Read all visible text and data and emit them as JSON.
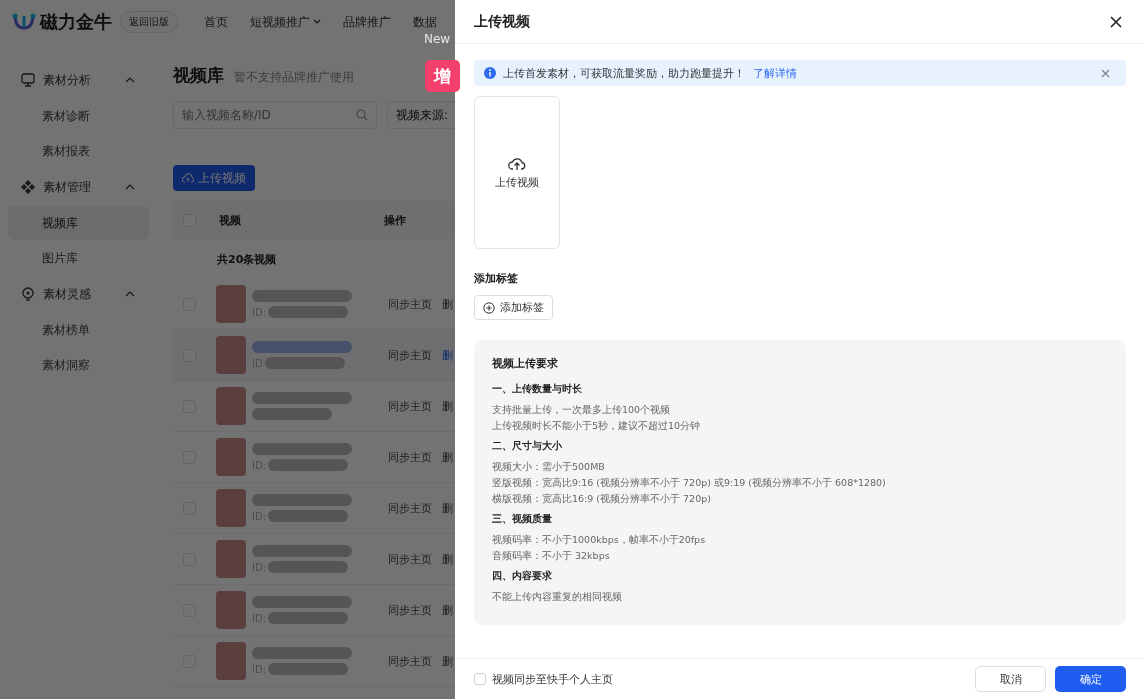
{
  "app": {
    "logo_text": "磁力金牛",
    "version_button": "返回旧版",
    "nav": [
      {
        "label": "首页",
        "dropdown": false
      },
      {
        "label": "短视频推广",
        "dropdown": true
      },
      {
        "label": "品牌推广",
        "dropdown": false
      },
      {
        "label": "数据",
        "dropdown": false
      }
    ],
    "new_badge": "New"
  },
  "sidebar": {
    "groups": [
      {
        "label": "素材分析",
        "expanded": true,
        "children": [
          {
            "label": "素材诊断",
            "selected": false
          },
          {
            "label": "素材报表",
            "selected": false
          }
        ]
      },
      {
        "label": "素材管理",
        "expanded": true,
        "children": [
          {
            "label": "视频库",
            "selected": true
          },
          {
            "label": "图片库",
            "selected": false
          }
        ]
      },
      {
        "label": "素材灵感",
        "expanded": true,
        "children": [
          {
            "label": "素材榜单",
            "selected": false
          },
          {
            "label": "素材洞察",
            "selected": false
          }
        ]
      }
    ]
  },
  "page": {
    "title": "视频库",
    "subtitle": "暂不支持品牌推广使用",
    "search_placeholder": "输入视频名称/ID",
    "filter_label": "视频来源:",
    "upload_button": "上传视频",
    "table": {
      "columns": [
        "视频",
        "操作"
      ],
      "all_checked": false,
      "total": "共20条视频",
      "rows": [
        {
          "id_label": "ID:",
          "hovered": false,
          "checked": false,
          "sync": "同步主页",
          "delete": "删"
        },
        {
          "id_label": "ID",
          "hovered": true,
          "checked": false,
          "sync": "同步主页",
          "delete": "删"
        },
        {
          "hovered": false,
          "checked": false,
          "sync": "同步主页",
          "delete": "删"
        },
        {
          "id_label": "ID:",
          "hovered": false,
          "checked": false,
          "sync": "同步主页",
          "delete": "删"
        },
        {
          "id_label": "ID:",
          "hovered": false,
          "checked": false,
          "sync": "同步主页",
          "delete": "删"
        },
        {
          "id_label": "ID:",
          "hovered": false,
          "checked": false,
          "sync": "同步主页",
          "delete": "删"
        },
        {
          "id_label": "ID:",
          "hovered": false,
          "checked": false,
          "sync": "同步主页",
          "delete": "删"
        },
        {
          "id_label": "ID:",
          "hovered": false,
          "checked": false,
          "sync": "同步主页",
          "delete": "删"
        }
      ]
    }
  },
  "feature_tag": "增",
  "drawer": {
    "title": "上传视频",
    "alert": {
      "text": "上传首发素材，可获取流量奖励，助力跑量提升！",
      "link": "了解详情"
    },
    "upload_label": "上传视频",
    "tags_label": "添加标签",
    "add_tag_button": "添加标签",
    "requirements": {
      "title": "视频上传要求",
      "sections": [
        {
          "heading": "一、上传数量与时长",
          "lines": [
            "支持批量上传，一次最多上传100个视频",
            "上传视频时长不能小于5秒，建议不超过10分钟"
          ]
        },
        {
          "heading": "二、尺寸与大小",
          "lines": [
            "视频大小：需小于500MB",
            "竖版视频：宽高比9:16 (视频分辨率不小于 720p) 或9:19 (视频分辨率不小于 608*1280)",
            "横版视频：宽高比16:9 (视频分辨率不小于 720p)"
          ]
        },
        {
          "heading": "三、视频质量",
          "lines": [
            "视频码率：不小于1000kbps，帧率不小于20fps",
            "音频码率：不小于 32kbps"
          ]
        },
        {
          "heading": "四、内容要求",
          "lines": [
            "不能上传内容重复的相同视频"
          ]
        }
      ]
    },
    "sync_checkbox": {
      "label": "视频同步至快手个人主页",
      "checked": false
    },
    "buttons": [
      {
        "label": "取消",
        "kind": "secondary"
      },
      {
        "label": "确定",
        "kind": "primary"
      }
    ]
  }
}
